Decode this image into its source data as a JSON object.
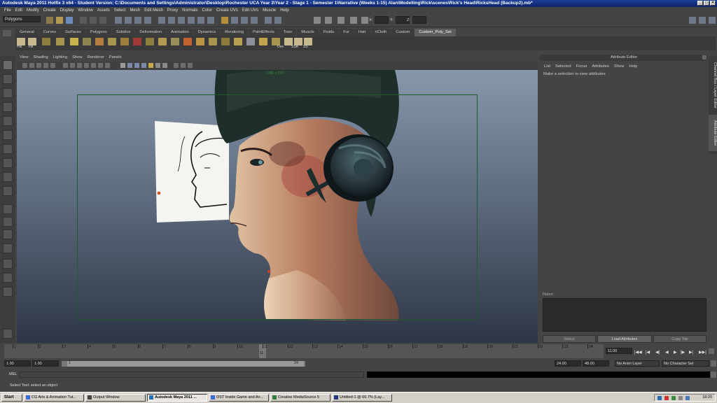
{
  "window": {
    "title": "Autodesk Maya 2011 Hotfix 3 x64 - Student Version: C:\\Documents and Settings\\Administrator\\Desktop\\Rochester UCA Year 2\\Year 2 - Stage 1 - Semester 1\\Narrative (Weeks 1-15) Alan\\Modelling\\Rick\\scenes\\Rick's Head\\RicksHead (Backup2).mb*"
  },
  "menubar": [
    "File",
    "Edit",
    "Modify",
    "Create",
    "Display",
    "Window",
    "Assets",
    "Select",
    "Mesh",
    "Edit Mesh",
    "Proxy",
    "Normals",
    "Color",
    "Create UVs",
    "Edit UVs",
    "Muscle",
    "Help"
  ],
  "statusline": {
    "mode": "Polygons",
    "x_label": "X:",
    "y_label": "Y:",
    "z_label": "Z:"
  },
  "shelf_tabs": [
    "General",
    "Curves",
    "Surfaces",
    "Polygons",
    "Subdivs",
    "Deformation",
    "Animation",
    "Dynamics",
    "Rendering",
    "PaintEffects",
    "Toon",
    "Muscle",
    "Fluids",
    "Fur",
    "Hair",
    "nCloth",
    "Custom",
    "Custom_Poly_Set"
  ],
  "shelf_active": "Custom_Poly_Set",
  "shelf_labels": {
    "his": "His",
    "fill": "Fill",
    "des": "Des",
    "ssa": "SSA",
    "ss": "SS"
  },
  "panel_menu": [
    "View",
    "Shading",
    "Lighting",
    "Show",
    "Renderer",
    "Panels"
  ],
  "viewport": {
    "resolution": "1280 x 720"
  },
  "attribute_editor": {
    "title": "Attribute Editor",
    "menu": [
      "List",
      "Selected",
      "Focus",
      "Attributes",
      "Show",
      "Help"
    ],
    "message": "Make a selection to view attributes",
    "notes_label": "Notes:",
    "buttons": {
      "select": "Select",
      "load": "Load Attributes",
      "copy": "Copy Tab"
    }
  },
  "side_tabs": [
    "Channel Box / Layer Editor",
    "Attribute Editor"
  ],
  "time_slider": {
    "ticks": [
      "1",
      "2",
      "3",
      "4",
      "5",
      "6",
      "7",
      "8",
      "9",
      "10",
      "11",
      "12",
      "13",
      "14",
      "15",
      "16",
      "17",
      "18",
      "19",
      "20",
      "21",
      "22",
      "23",
      "24"
    ],
    "current": "11",
    "current_field": "11.00"
  },
  "range": {
    "start": "1.00",
    "playback_start": "1.00",
    "range_start_label": "1",
    "range_end_label": "24",
    "playback_end": "24.00",
    "end": "48.00",
    "anim_layer": "No Anim Layer",
    "character_set": "No Character Set"
  },
  "command_line": {
    "label": "MEL"
  },
  "help_line": "Select Tool: select an object",
  "taskbar": {
    "start": "Start",
    "tasks": [
      "CG Arts & Animation Tut...",
      "Output Window",
      "Autodesk Maya 2011 ...",
      "OST Inside Game and An...",
      "Creative MediaSource 5",
      "Untitled-1 @ 66.7% (Lay..."
    ],
    "active_task": "Autodesk Maya 2011 ...",
    "clock": "18:20"
  }
}
